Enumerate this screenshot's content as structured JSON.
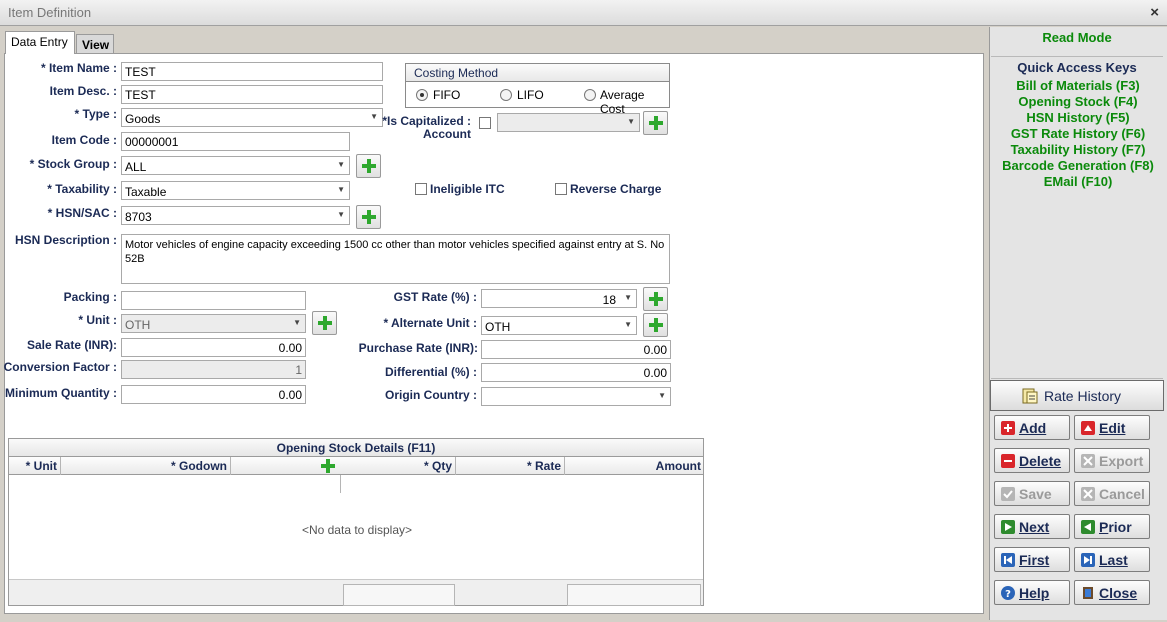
{
  "window": {
    "title": "Item Definition",
    "close_glyph": "×"
  },
  "tabs": [
    {
      "label": "Data Entry",
      "active": true
    },
    {
      "label": "View",
      "active": false
    }
  ],
  "form": {
    "item_name": {
      "label": "* Item Name :",
      "value": "TEST"
    },
    "item_desc": {
      "label": "Item Desc. :",
      "value": "TEST"
    },
    "type": {
      "label": "* Type :",
      "value": "Goods"
    },
    "item_code": {
      "label": "Item Code :",
      "value": "00000001"
    },
    "stock_group": {
      "label": "* Stock Group :",
      "value": "ALL"
    },
    "taxability": {
      "label": "* Taxability :",
      "value": "Taxable"
    },
    "hsn_sac": {
      "label": "* HSN/SAC :",
      "value": "8703"
    },
    "hsn_description": {
      "label": "HSN Description :",
      "value": "Motor vehicles of engine capacity exceeding 1500 cc other than motor vehicles specified against entry at S. No 52B"
    },
    "packing": {
      "label": "Packing :",
      "value": ""
    },
    "unit": {
      "label": "* Unit :",
      "value": "OTH"
    },
    "sale_rate": {
      "label": "Sale Rate (INR):",
      "value": "0.00"
    },
    "conversion_factor": {
      "label": "Conversion Factor :",
      "value": "1"
    },
    "minimum_quantity": {
      "label": "Minimum Quantity :",
      "value": "0.00"
    },
    "is_capitalized": {
      "label_line1": "*Is Capitalized :",
      "label_line2": "Account",
      "value": ""
    },
    "ineligible_itc": {
      "label": "Ineligible ITC"
    },
    "reverse_charge": {
      "label": "Reverse Charge"
    },
    "gst_rate": {
      "label": "GST Rate (%) :",
      "value": "18"
    },
    "alternate_unit": {
      "label": "* Alternate Unit :",
      "value": "OTH"
    },
    "purchase_rate": {
      "label": "Purchase Rate (INR):",
      "value": "0.00"
    },
    "differential": {
      "label": "Differential (%) :",
      "value": "0.00"
    },
    "origin_country": {
      "label": "Origin Country :",
      "value": ""
    }
  },
  "costing_method": {
    "title": "Costing Method",
    "options": [
      "FIFO",
      "LIFO",
      "Average Cost"
    ],
    "selected": "FIFO"
  },
  "opening_stock": {
    "caption": "Opening Stock Details (F11)",
    "columns": [
      "* Unit",
      "* Godown",
      "* Qty",
      "* Rate",
      "Amount"
    ],
    "empty_text": "<No data to display>"
  },
  "sidebar": {
    "mode": "Read Mode",
    "quick_access_title": "Quick Access Keys",
    "quick_access": [
      "Bill of Materials (F3)",
      "Opening Stock (F4)",
      "HSN History (F5)",
      "GST Rate History (F6)",
      "Taxability History (F7)",
      "Barcode Generation (F8)",
      "EMail (F10)"
    ],
    "rate_history": "Rate History"
  },
  "buttons": {
    "add": "Add",
    "edit": "Edit",
    "delete": "Delete",
    "export": "Export",
    "save": "Save",
    "cancel": "Cancel",
    "next": "Next",
    "prior": "Prior",
    "first": "First",
    "last": "Last",
    "help": "Help",
    "close": "Close"
  },
  "colors": {
    "accent_green": "#0b8a0b",
    "label_navy": "#1b2a55",
    "background": "#d4d0c8"
  },
  "icons": {
    "plus": "green-plus-icon",
    "add": "red-plus-icon",
    "edit": "red-triangle-icon",
    "delete": "red-minus-icon",
    "export": "export-icon",
    "save": "check-icon",
    "cancel": "x-icon",
    "next": "play-next-icon",
    "prior": "prior-icon",
    "first": "first-icon",
    "last": "last-icon",
    "help": "help-icon",
    "close": "door-icon",
    "rate_history": "rate-history-icon"
  }
}
